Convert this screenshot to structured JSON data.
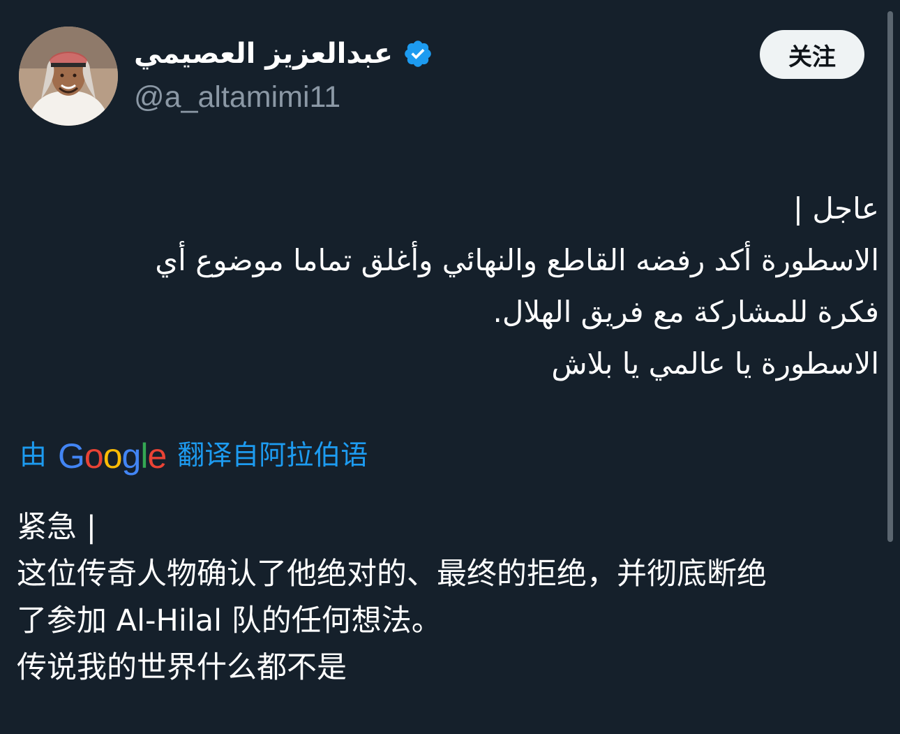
{
  "profile": {
    "display_name": "عبدالعزيز العصيمي",
    "handle": "@a_altamimi11",
    "verified_icon": "verified-badge-icon",
    "follow_label": "关注"
  },
  "tweet": {
    "original_lines": [
      "عاجل |",
      "الاسطورة أكد رفضه القاطع والنهائي وأغلق تماما موضوع أي",
      "فكرة للمشاركة مع فريق الهلال.",
      "الاسطورة يا عالمي يا بلاش"
    ],
    "translation": {
      "by_label": "由",
      "provider": "Google",
      "from_label": "翻译自阿拉伯语"
    },
    "translated_lines": [
      "紧急 |",
      "这位传奇人物确认了他绝对的、最终的拒绝，并彻底断绝",
      "了参加 Al-Hilal 队的任何想法。",
      "传说我的世界什么都不是"
    ]
  },
  "colors": {
    "background": "#15202b",
    "text_primary": "#ffffff",
    "text_secondary": "#8b98a5",
    "accent": "#1d9bf0",
    "follow_bg": "#eff3f4",
    "google_blue": "#4285f4",
    "google_red": "#ea4335",
    "google_yellow": "#fbbc05",
    "google_green": "#34a853"
  }
}
